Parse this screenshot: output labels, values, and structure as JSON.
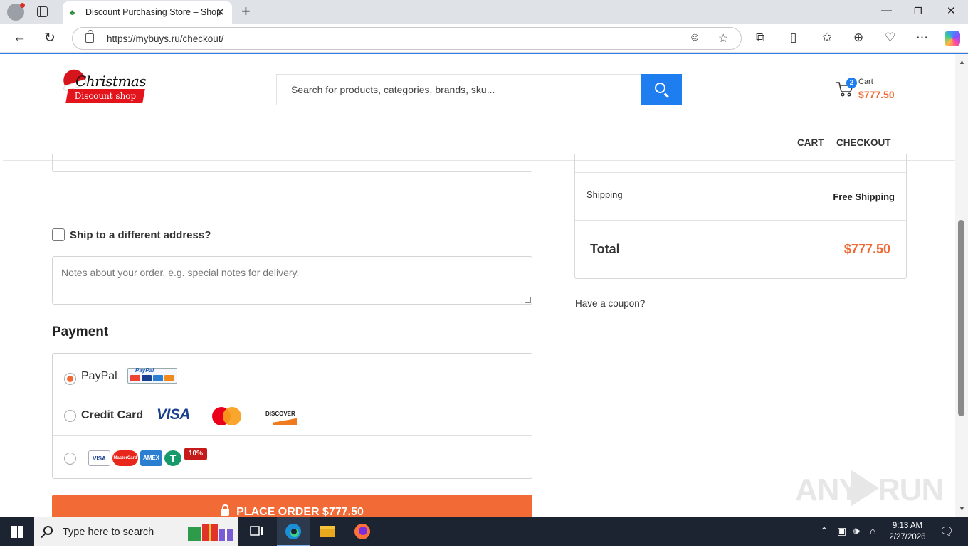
{
  "browser": {
    "tab_title": "Discount Purchasing Store – Shop",
    "url": "https://mybuys.ru/checkout/"
  },
  "site": {
    "logo_script": "Christmas",
    "logo_banner": "Discount shop",
    "search_placeholder": "Search for products, categories, brands, sku...",
    "cart": {
      "count": "2",
      "label": "Cart",
      "amount": "$777.50"
    },
    "nav": [
      "CART",
      "CHECKOUT"
    ]
  },
  "checkout": {
    "ship_different_label": "Ship to a different address?",
    "ship_different_checked": false,
    "notes_placeholder": "Notes about your order, e.g. special notes for delivery.",
    "payment_heading": "Payment",
    "payment_methods": [
      {
        "label": "PayPal",
        "selected": true
      },
      {
        "label": "Credit Card",
        "selected": false
      },
      {
        "label": "",
        "selected": false
      }
    ],
    "card_logos": {
      "visa": "VISA",
      "discover": "DISCOVER",
      "strip_visa": "VISA",
      "strip_mc": "MasterCard",
      "strip_amex": "AMEX",
      "strip_discount": "10%"
    },
    "paypal_badge": "PayPal",
    "place_order": "PLACE ORDER  $777.50"
  },
  "summary": {
    "shipping_label": "Shipping",
    "shipping_value": "Free Shipping",
    "total_label": "Total",
    "total_value": "$777.50",
    "coupon_link": "Have a coupon?"
  },
  "watermark": {
    "left": "ANY",
    "right": "RUN"
  },
  "taskbar": {
    "search_placeholder": "Type here to search",
    "time": "9:13 AM",
    "date": "2/27/2026"
  },
  "colors": {
    "accent_orange": "#f26a35",
    "search_blue": "#1e7ef0"
  }
}
